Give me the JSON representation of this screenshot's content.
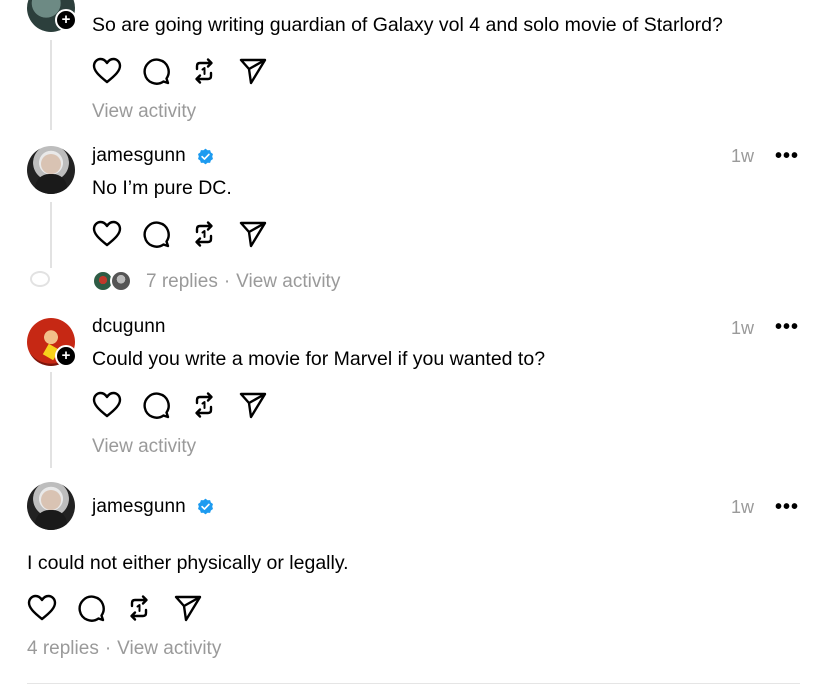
{
  "posts": [
    {
      "text": "So are going writing guardian of Galaxy vol 4 and solo movie of Starlord?",
      "view_activity": "View activity"
    },
    {
      "username": "jamesgunn",
      "time": "1w",
      "text": "No I’m pure DC.",
      "replies": "7 replies",
      "separator": "·",
      "view_activity": "View activity"
    },
    {
      "username": "dcugunn",
      "time": "1w",
      "text": "Could you write a movie for Marvel if you wanted to?",
      "view_activity": "View activity"
    },
    {
      "username": "jamesgunn",
      "time": "1w",
      "text": "I could not either physically or legally.",
      "replies": "4 replies",
      "separator": "·",
      "view_activity": "View activity"
    }
  ],
  "more_glyph": "•••",
  "plus_glyph": "+",
  "icons": [
    "heart-icon",
    "comment-icon",
    "repost-icon",
    "share-icon"
  ],
  "colors": {
    "verified": "#1d9bf0",
    "muted": "#9a9a9a",
    "thread_line": "#e2e2e2"
  }
}
